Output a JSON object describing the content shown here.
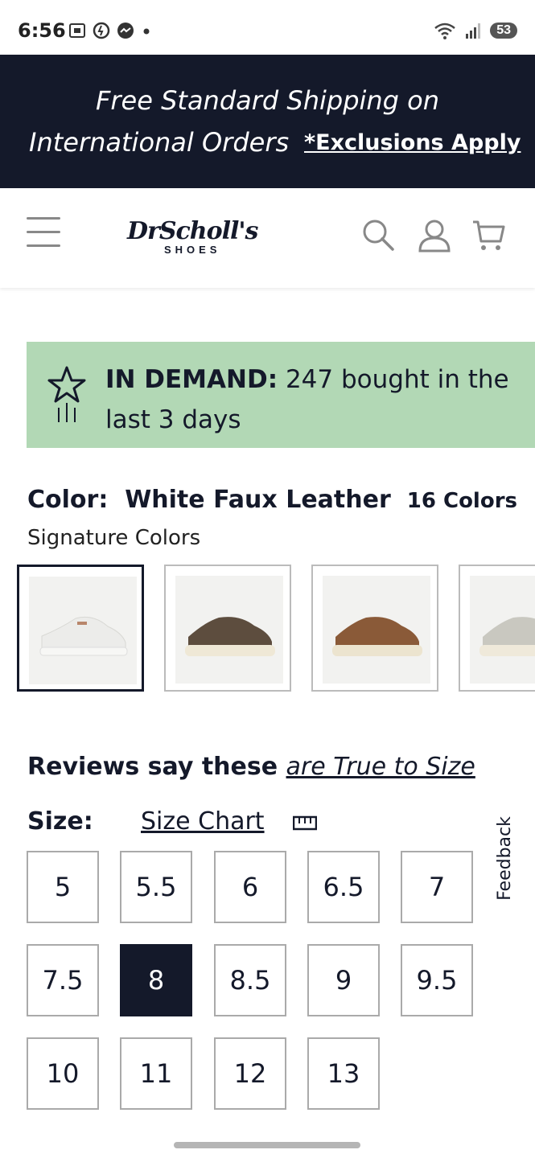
{
  "status_bar": {
    "time": "6:56",
    "battery": "53"
  },
  "promo": {
    "line1": "Free Standard Shipping on",
    "line2": "International Orders",
    "link": "*Exclusions Apply"
  },
  "header": {
    "brand": "DrScholl's",
    "brand_sub": "SHOES"
  },
  "demand": {
    "bold": "IN DEMAND:",
    "text": " 247 bought in the last 3 days"
  },
  "color": {
    "label": "Color:",
    "value": "White Faux Leather",
    "count": "16 Colors",
    "group": "Signature Colors"
  },
  "swatches": [
    {
      "name": "white",
      "shoe_color": "#ececea",
      "sole_color": "#f7f7f5"
    },
    {
      "name": "brown",
      "shoe_color": "#5d4d3e",
      "sole_color": "#efe8d6"
    },
    {
      "name": "tan",
      "shoe_color": "#8a5a38",
      "sole_color": "#ece4cf"
    },
    {
      "name": "grey",
      "shoe_color": "#c9c8c0",
      "sole_color": "#efe9da"
    }
  ],
  "reviews": {
    "prefix": "Reviews say these ",
    "link": "are True to Size"
  },
  "size": {
    "label": "Size:",
    "chart_link": "Size Chart",
    "options": [
      "5",
      "5.5",
      "6",
      "6.5",
      "7",
      "7.5",
      "8",
      "8.5",
      "9",
      "9.5",
      "10",
      "11",
      "12",
      "13"
    ],
    "selected": "8"
  },
  "feedback": "Feedback",
  "colors": {
    "navy": "#14192a",
    "demand_bg": "#b2d8b5"
  }
}
